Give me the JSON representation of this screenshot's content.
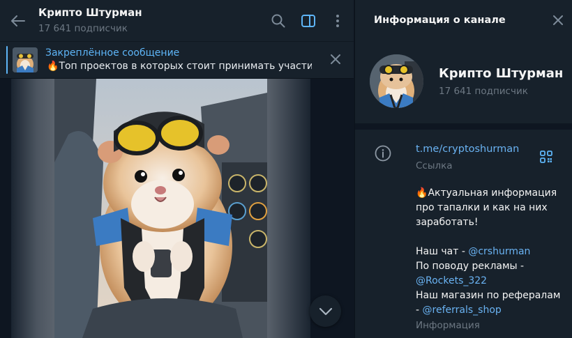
{
  "chat": {
    "title": "Крипто Штурман",
    "subscribers": "17 641 подписчик",
    "icons": [
      "back-arrow-icon",
      "search-icon",
      "sidebar-toggle-icon",
      "more-vertical-icon"
    ]
  },
  "pinned": {
    "title": "Закреплённое сообщение",
    "emoji": "🔥",
    "text": "Топ проектов в которых стоит принимать участи..."
  },
  "info_panel": {
    "header": "Информация о канале",
    "name": "Крипто Штурман",
    "subscribers": "17 641 подписчик",
    "link": "t.me/cryptoshurman",
    "link_label": "Ссылка",
    "description": {
      "emoji": "🔥",
      "line1": "Актуальная информация",
      "line2": "про тапалки и как на них",
      "line3": "заработать!",
      "chat_prefix": "Наш чат - ",
      "chat_mention": "@crshurman",
      "ads_prefix": "По поводу рекламы -",
      "ads_mention": "@Rockets_322",
      "shop_prefix": "Наш магазин по рефералам",
      "shop_dash": "- ",
      "shop_mention": "@referrals_shop"
    },
    "description_label": "Информация"
  },
  "colors": {
    "background": "#0e1621",
    "panel": "#17212b",
    "accent": "#5eb5f7",
    "link": "#6ab3f3",
    "muted": "#6d7883"
  }
}
